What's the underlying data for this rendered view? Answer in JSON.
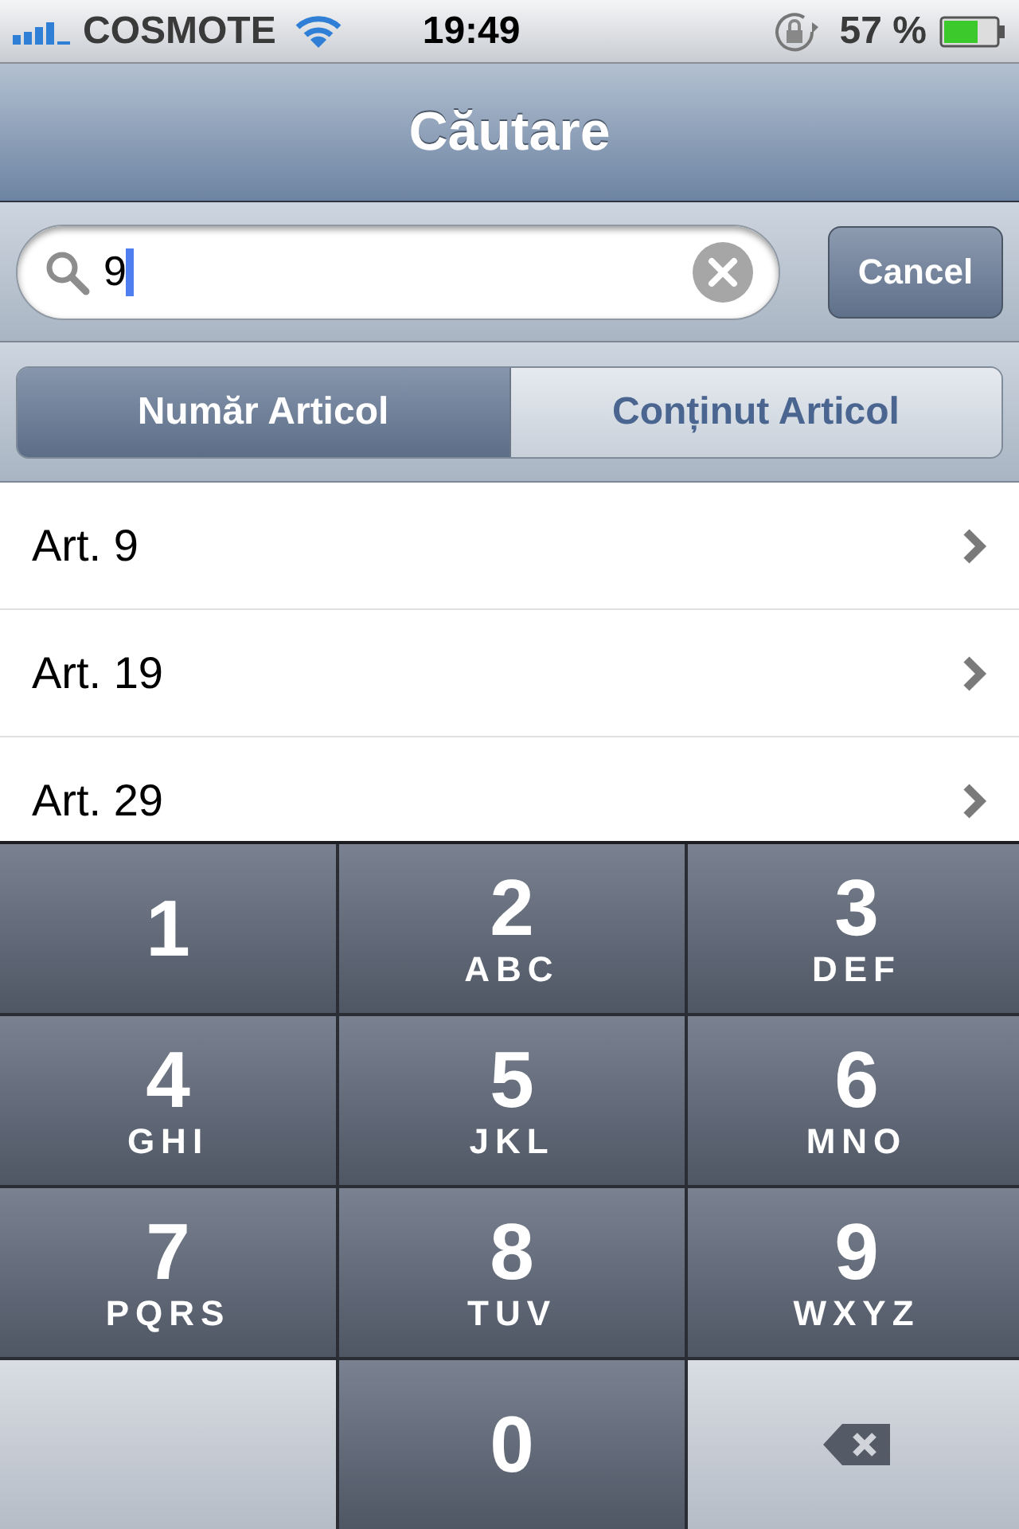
{
  "status_bar": {
    "carrier": "COSMOTE",
    "time": "19:49",
    "battery": "57 %"
  },
  "nav_bar": {
    "title": "Căutare"
  },
  "search": {
    "value": "9",
    "cancel": "Cancel"
  },
  "segments": [
    {
      "label": "Număr Articol",
      "selected": true
    },
    {
      "label": "Conținut Articol",
      "selected": false
    }
  ],
  "results": [
    "Art. 9",
    "Art. 19",
    "Art. 29"
  ],
  "keypad": [
    {
      "kind": "digit",
      "digit": "1"
    },
    {
      "kind": "digit",
      "digit": "2",
      "letters": "ABC"
    },
    {
      "kind": "digit",
      "digit": "3",
      "letters": "DEF"
    },
    {
      "kind": "digit",
      "digit": "4",
      "letters": "GHI"
    },
    {
      "kind": "digit",
      "digit": "5",
      "letters": "JKL"
    },
    {
      "kind": "digit",
      "digit": "6",
      "letters": "MNO"
    },
    {
      "kind": "digit",
      "digit": "7",
      "letters": "PQRS"
    },
    {
      "kind": "digit",
      "digit": "8",
      "letters": "TUV"
    },
    {
      "kind": "digit",
      "digit": "9",
      "letters": "WXYZ"
    },
    {
      "kind": "blank"
    },
    {
      "kind": "digit",
      "digit": "0"
    },
    {
      "kind": "delete"
    }
  ]
}
